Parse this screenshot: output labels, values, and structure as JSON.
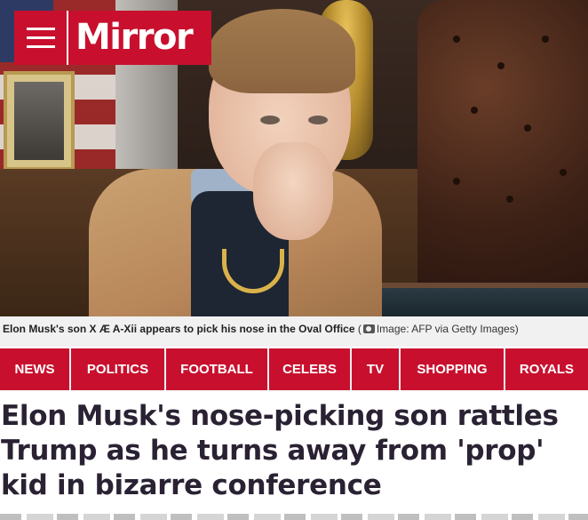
{
  "brand": {
    "name": "Mirror",
    "color": "#c8102e"
  },
  "hero_image": {
    "caption_main": "Elon Musk's son X Æ A-Xii appears to pick his nose in the Oval Office",
    "caption_credit": "Image: AFP via Getty Images",
    "credit_icon": "camera-icon"
  },
  "nav": {
    "items": [
      {
        "label": "NEWS"
      },
      {
        "label": "POLITICS"
      },
      {
        "label": "FOOTBALL"
      },
      {
        "label": "CELEBS"
      },
      {
        "label": "TV"
      },
      {
        "label": "SHOPPING"
      },
      {
        "label": "ROYALS"
      }
    ]
  },
  "article": {
    "headline": "Elon Musk's nose-picking son rattles Trump as he turns away from 'prop' kid in bizarre conference"
  },
  "colors": {
    "accent": "#c8102e",
    "headline_text": "#2a2233",
    "caption_bg": "#f1f1f1"
  }
}
